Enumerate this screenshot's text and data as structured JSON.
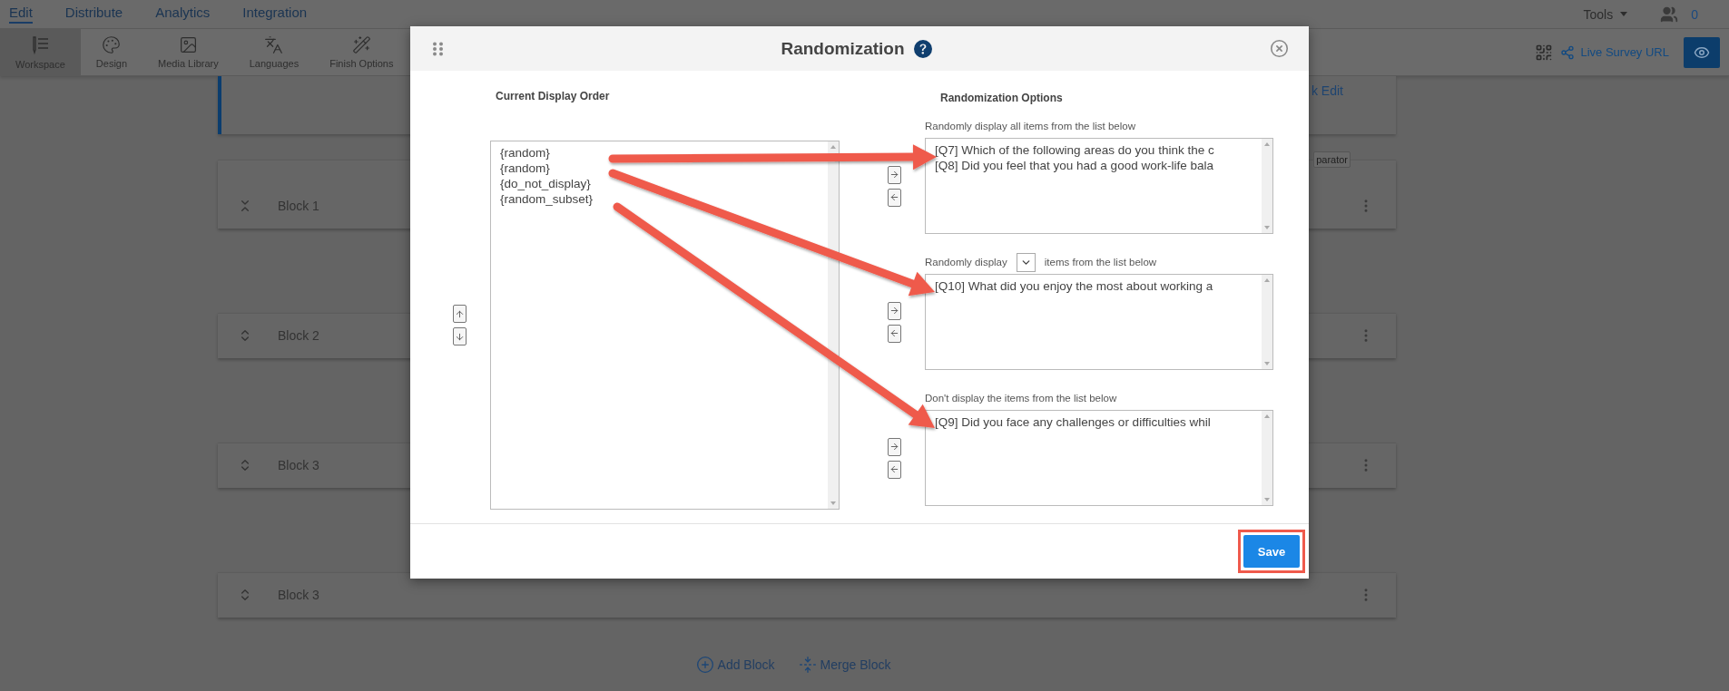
{
  "nav_tabs": [
    {
      "label": "Edit",
      "selected": true
    },
    {
      "label": "Distribute",
      "selected": false
    },
    {
      "label": "Analytics",
      "selected": false
    },
    {
      "label": "Integration",
      "selected": false
    }
  ],
  "top_right": {
    "tools_menu": "Tools",
    "collaborators_count": "0"
  },
  "toolbar": {
    "items": [
      {
        "label": "Workspace",
        "kind": "workspace",
        "selected": true
      },
      {
        "label": "Design",
        "kind": "palette",
        "selected": false
      },
      {
        "label": "Media Library",
        "kind": "image",
        "selected": false
      },
      {
        "label": "Languages",
        "kind": "translate",
        "selected": false
      },
      {
        "label": "Finish Options",
        "kind": "wand",
        "selected": false
      }
    ],
    "share_link": "Live Survey URL"
  },
  "page": {
    "top_card_link": "k Edit",
    "separator_tag": "parator",
    "blocks": [
      {
        "title": "Block 1",
        "expanded": true
      },
      {
        "title": "Block 2",
        "expanded": false
      },
      {
        "title": "Block 3",
        "expanded": false
      },
      {
        "title": "Block 3",
        "expanded": false
      }
    ],
    "actions": [
      {
        "kind": "add",
        "label": "Add Block"
      },
      {
        "kind": "merge",
        "label": "Merge Block"
      }
    ]
  },
  "dialog": {
    "title": "Randomization",
    "current_order": {
      "heading": "Current Display Order",
      "items": [
        "{random}",
        "{random}",
        "{do_not_display}",
        "{random_subset}"
      ]
    },
    "options": {
      "heading": "Randomization Options",
      "groups": [
        {
          "kind": "all",
          "label": "Randomly display all items from the list below",
          "items": [
            "[Q7] Which of the following areas do you think the c",
            "[Q8] Did you feel that you had a good work-life bala"
          ]
        },
        {
          "kind": "subset",
          "label": "Randomly display",
          "label_after": "items from the list below",
          "items": [
            "[Q10] What did you enjoy the most about working a"
          ]
        },
        {
          "kind": "exclude",
          "label": "Don't display the items from the list below",
          "items": [
            "[Q9] Did you face any challenges or difficulties whil"
          ]
        }
      ]
    },
    "save_button": "Save"
  }
}
